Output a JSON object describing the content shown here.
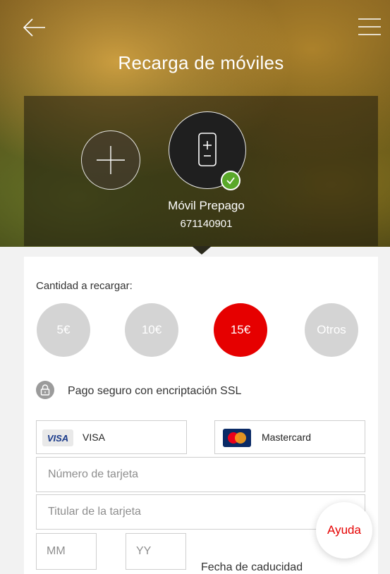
{
  "header": {
    "title": "Recarga de móviles",
    "back_icon": "arrow-left-icon",
    "menu_icon": "hamburger-menu-icon"
  },
  "account": {
    "add_icon": "plus-icon",
    "phone_icon": "mobile-phone-icon",
    "check_icon": "checkmark-icon",
    "name": "Móvil Prepago",
    "number": "671140901"
  },
  "recharge": {
    "label": "Cantidad a recargar:",
    "options": [
      "5€",
      "10€",
      "15€",
      "Otros"
    ],
    "selected": "15€"
  },
  "secure": {
    "icon": "lock-icon",
    "text": "Pago seguro con encriptación SSL"
  },
  "payment": {
    "visa_logo": "VISA",
    "visa_label": "VISA",
    "mastercard_label": "Mastercard"
  },
  "form": {
    "card_number_placeholder": "Número de tarjeta",
    "card_holder_placeholder": "Titular de la tarjeta",
    "month_placeholder": "MM",
    "year_placeholder": "YY",
    "expiry_label": "Fecha de caducidad"
  },
  "help": {
    "label": "Ayuda"
  },
  "colors": {
    "accent_red": "#e60000",
    "check_green": "#5aa82a",
    "option_gray": "#d4d4d4"
  }
}
